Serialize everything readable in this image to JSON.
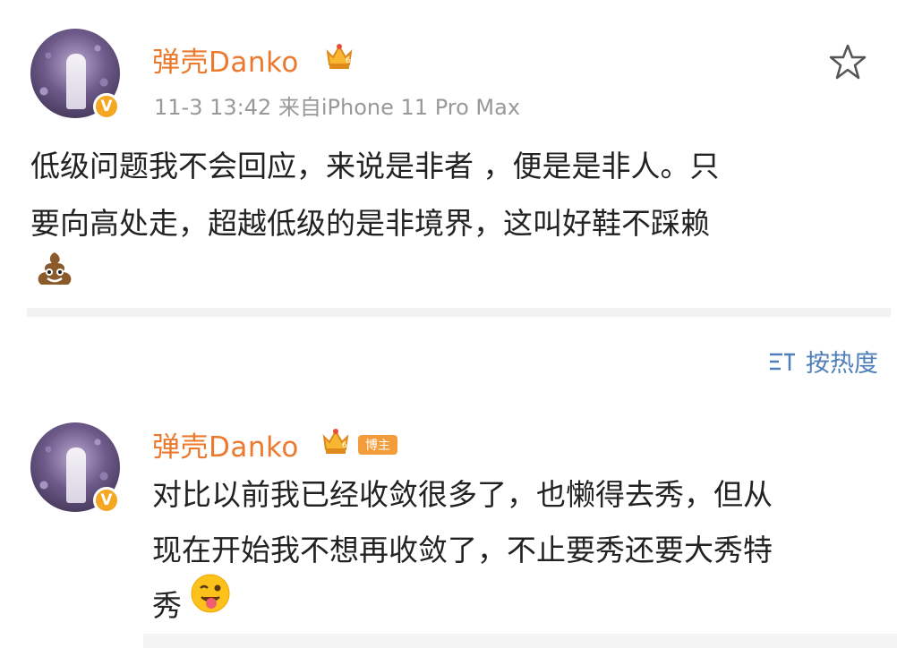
{
  "post": {
    "username": "弹壳Danko",
    "meta": "11-3 13:42  来自iPhone 11 Pro Max",
    "content_line1": "低级问题我不会回应，来说是非者 ，便是是非人。只",
    "content_line2": "要向高处走，超越低级的是非境界，这叫好鞋不踩赖",
    "emoji": "poop-emoji",
    "verified_badge": "V",
    "favorite_icon": "star-icon"
  },
  "sort": {
    "label": "按热度",
    "icon": "sort-icon"
  },
  "comment": {
    "username": "弹壳Danko",
    "tag": "博主",
    "content_line1": "对比以前我已经收敛很多了，也懒得去秀，但从",
    "content_line2": "现在开始我不想再收敛了，不止要秀还要大秀特",
    "content_line3": "秀",
    "emoji": "tongue-wink-emoji",
    "verified_badge": "V"
  },
  "colors": {
    "username": "#eb7a2e",
    "meta": "#999999",
    "link": "#4f7fb8",
    "badge": "#f5a623",
    "divider": "#f2f2f2"
  }
}
